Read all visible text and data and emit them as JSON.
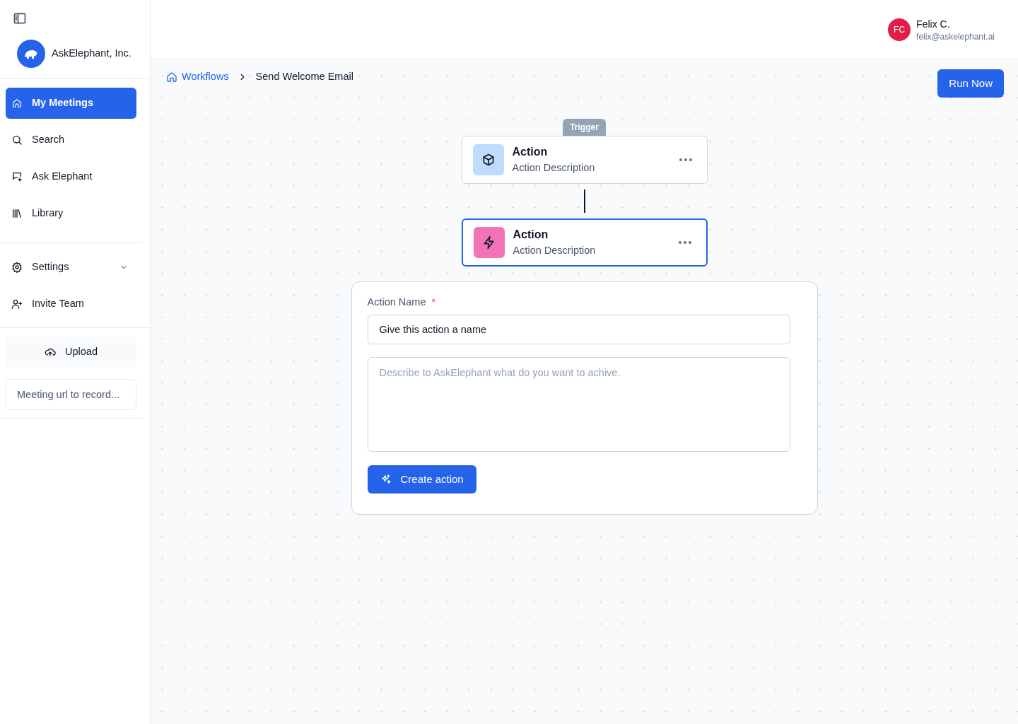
{
  "sidebar": {
    "org_name": "AskElephant, Inc.",
    "nav": [
      {
        "label": "My Meetings",
        "selected": true
      },
      {
        "label": "Search",
        "selected": false
      },
      {
        "label": "Ask Elephant",
        "selected": false
      },
      {
        "label": "Library",
        "selected": false
      }
    ],
    "secondary": [
      {
        "label": "Settings",
        "kind": "dropdown",
        "expanded": false
      },
      {
        "label": "Invite Team",
        "kind": "link"
      }
    ],
    "upload_button": "Upload",
    "meeting_url": {
      "placeholder": "Meeting url to record..."
    }
  },
  "user": {
    "initials": "FC",
    "name": "Felix C.",
    "email": "felix@askelephant.ai"
  },
  "breadcrumb": [
    {
      "label": "Workflows",
      "kind": "link"
    },
    {
      "label": "Send Welcome Email",
      "kind": "current"
    }
  ],
  "run_button": "Run Now",
  "nodes": [
    {
      "kind": "trigger",
      "badge": "Trigger",
      "title": "Action",
      "description": "Action Description",
      "color": "#bfdbfe",
      "selected": false
    },
    {
      "kind": "action",
      "title": "Action",
      "description": "Action Description",
      "color": "#f472b6",
      "selected": true
    }
  ],
  "form": {
    "name_label": "Action Name",
    "required_mark": "*",
    "name_value": "Give this action a name",
    "description": {
      "placeholder": "Describe to AskElephant what do you want to achive."
    },
    "submit": "Create action"
  }
}
